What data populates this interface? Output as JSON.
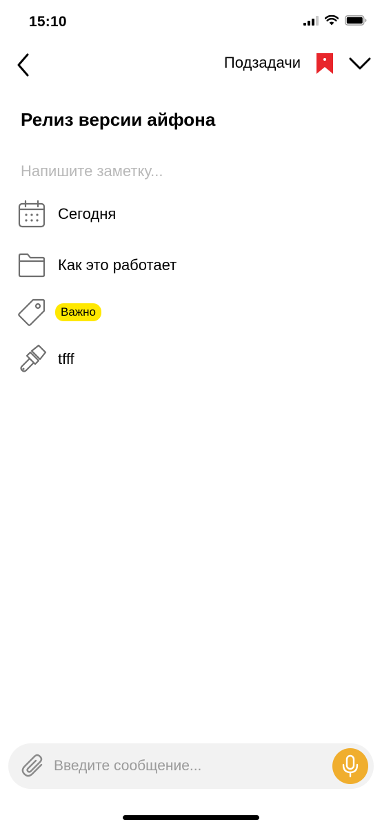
{
  "status_bar": {
    "time": "15:10",
    "icons": [
      "cellular-signal-icon",
      "wifi-icon",
      "battery-icon"
    ]
  },
  "header": {
    "back_icon": "chevron-left-icon",
    "subtasks_label": "Подзадачи",
    "bookmark_icon": "bookmark-icon",
    "bookmark_color": "#e8262b",
    "menu_icon": "chevron-down-icon"
  },
  "task": {
    "title": "Релиз версии айфона",
    "note_placeholder": "Напишите заметку...",
    "note_value": ""
  },
  "properties": {
    "date": {
      "icon": "calendar-icon",
      "label": "Сегодня"
    },
    "project": {
      "icon": "folder-icon",
      "label": "Как это работает"
    },
    "tags": {
      "icon": "tag-icon",
      "items": [
        {
          "label": "Важно",
          "color": "#ffe800"
        }
      ]
    },
    "color": {
      "icon": "paintbrush-icon",
      "label": "tfff"
    }
  },
  "composer": {
    "attach_icon": "paperclip-icon",
    "placeholder": "Введите сообщение...",
    "value": "",
    "mic_icon": "microphone-icon",
    "mic_color": "#f0ae2e"
  }
}
